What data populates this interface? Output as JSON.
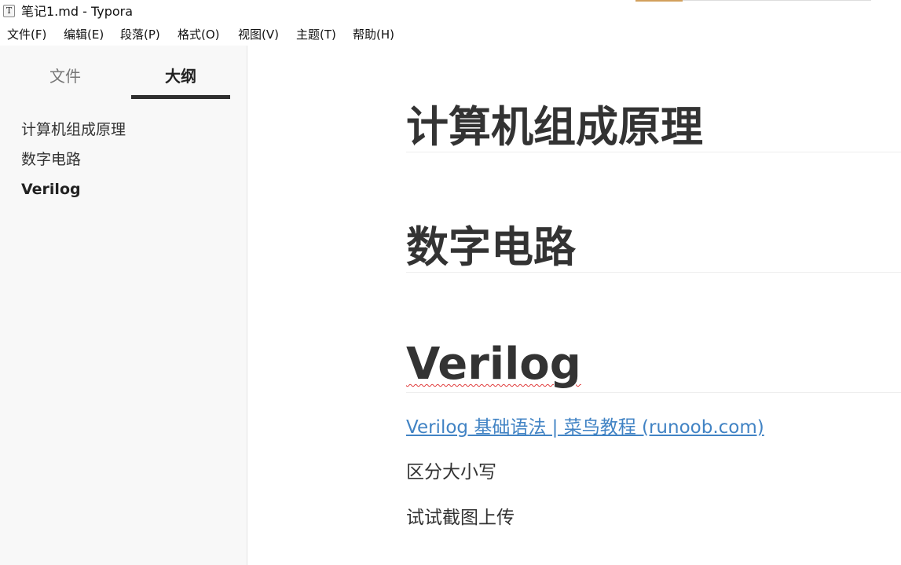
{
  "window": {
    "title": "笔记1.md - Typora",
    "app_icon_glyph": "T"
  },
  "menubar": {
    "items": [
      {
        "label": "文件(F)"
      },
      {
        "label": "编辑(E)"
      },
      {
        "label": "段落(P)"
      },
      {
        "label": "格式(O)"
      },
      {
        "label": "视图(V)"
      },
      {
        "label": "主题(T)"
      },
      {
        "label": "帮助(H)"
      }
    ]
  },
  "sidebar": {
    "tabs": [
      {
        "label": "文件",
        "active": false
      },
      {
        "label": "大纲",
        "active": true
      }
    ],
    "outline": [
      {
        "label": "计算机组成原理",
        "active": false
      },
      {
        "label": "数字电路",
        "active": false
      },
      {
        "label": "Verilog",
        "active": true
      }
    ]
  },
  "document": {
    "headings": [
      {
        "text": "计算机组成原理"
      },
      {
        "text": "数字电路"
      },
      {
        "text": "Verilog"
      }
    ],
    "link_text": "Verilog 基础语法 | 菜鸟教程 (runoob.com)",
    "paragraphs": [
      {
        "text": "区分大小写"
      },
      {
        "text": "试试截图上传"
      }
    ]
  },
  "colors": {
    "link": "#4183c4",
    "text": "#333333",
    "sidebar_bg": "#f8f8f8",
    "spellcheck": "#e03a3a"
  }
}
